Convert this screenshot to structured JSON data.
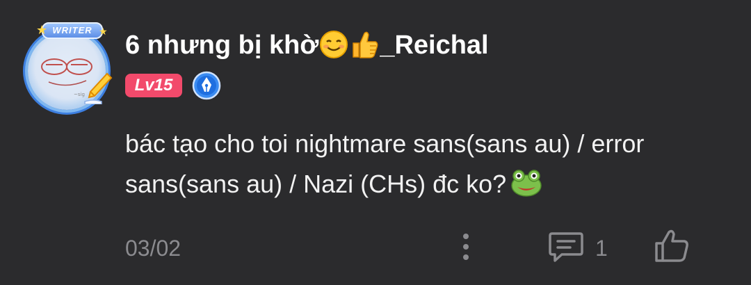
{
  "comment": {
    "avatar": {
      "badge_text": "WRITER"
    },
    "author": {
      "name_prefix": "6 nhưng bị khờ",
      "name_suffix": "_Reichal",
      "emojis": [
        "smiling-face-emoji",
        "thumbs-up-emoji"
      ]
    },
    "level": {
      "label": "Lv15"
    },
    "body": {
      "text": "bác tạo cho toi nightmare sans(sans au) / error sans(sans au) / Nazi (CHs) đc ko?",
      "emoji": "frog-emoji"
    },
    "footer": {
      "date": "03/02",
      "reply_count": "1"
    },
    "colors": {
      "background": "#2b2b2d",
      "text_primary": "#ffffff",
      "text_muted": "#8b8b8f",
      "level_badge": "#f24a6b",
      "writer_frame": "#3d7fe0"
    }
  }
}
